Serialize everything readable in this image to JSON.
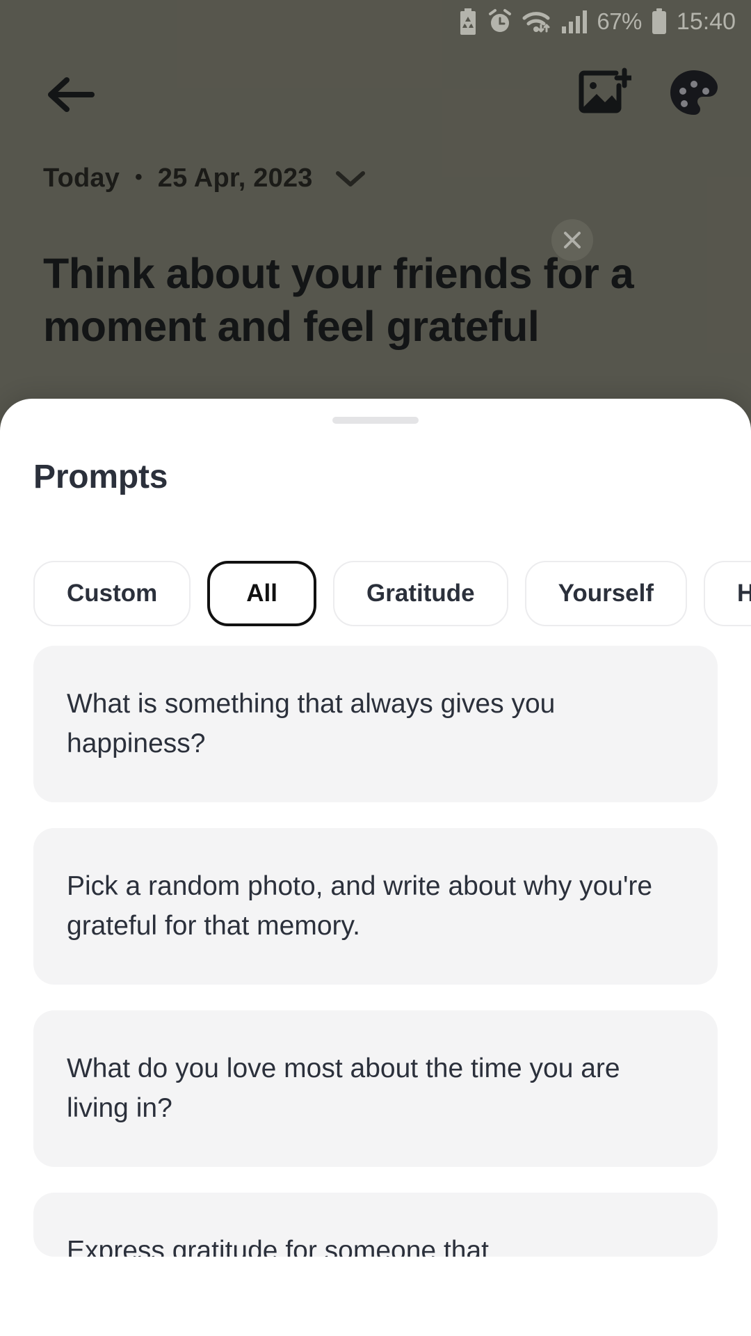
{
  "status_bar": {
    "icons": [
      "battery-saver-icon",
      "alarm-icon",
      "wifi-icon",
      "signal-icon"
    ],
    "battery_percent": "67%",
    "battery_icon": "battery-icon",
    "clock": "15:40"
  },
  "app_header": {
    "back_icon": "back-arrow-icon",
    "add_image_icon": "add-image-icon",
    "theme_icon": "palette-icon"
  },
  "entry": {
    "date_today": "Today",
    "date_separator": "•",
    "date_value": "25 Apr, 2023",
    "date_chevron_icon": "chevron-down-icon",
    "title": "Think about your friends for a moment and feel grateful",
    "close_icon": "close-icon"
  },
  "sheet": {
    "title": "Prompts",
    "handle": "drag-handle",
    "chips": [
      {
        "label": "Custom",
        "selected": false
      },
      {
        "label": "All",
        "selected": true
      },
      {
        "label": "Gratitude",
        "selected": false
      },
      {
        "label": "Yourself",
        "selected": false
      },
      {
        "label": "H",
        "selected": false
      }
    ],
    "prompts": [
      "What is something that always gives you happiness?",
      "Pick a random photo, and write about why you're grateful for that memory.",
      "What do you love most about the time you are living in?",
      "Express gratitude for someone that"
    ]
  },
  "colors": {
    "background": "#6a695e",
    "sheet": "#ffffff",
    "card": "#f4f4f5",
    "text_dark": "#2b303b",
    "selected_border": "#111111"
  }
}
